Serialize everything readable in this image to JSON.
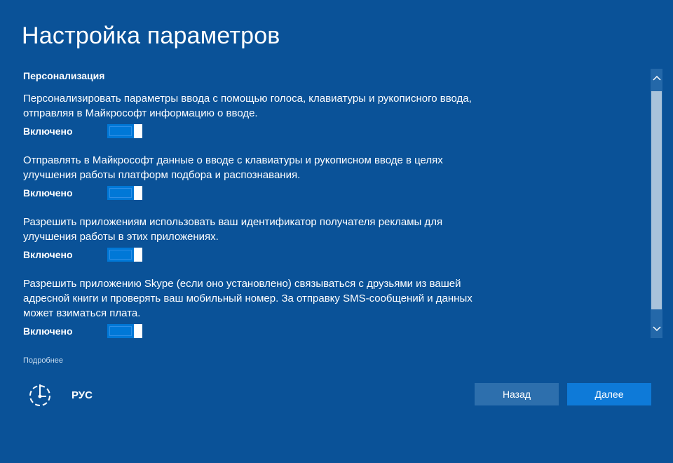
{
  "header": {
    "title": "Настройка параметров"
  },
  "section": {
    "title": "Персонализация",
    "settings": [
      {
        "description": "Персонализировать параметры ввода с помощью голоса, клавиатуры и рукописного ввода, отправляя в Майкрософт информацию о вводе.",
        "state_label": "Включено",
        "on": true
      },
      {
        "description": "Отправлять в Майкрософт данные о вводе с клавиатуры и рукописном вводе в целях улучшения работы платформ подбора и распознавания.",
        "state_label": "Включено",
        "on": true
      },
      {
        "description": "Разрешить приложениям использовать ваш идентификатор получателя рекламы для улучшения работы в этих приложениях.",
        "state_label": "Включено",
        "on": true
      },
      {
        "description": "Разрешить приложению Skype (если оно установлено) связываться с друзьями из вашей адресной книги и проверять ваш мобильный номер. За отправку SMS-сообщений и данных может взиматься плата.",
        "state_label": "Включено",
        "on": true
      }
    ]
  },
  "footer": {
    "more_link": "Подробнее",
    "language": "РУС",
    "back_label": "Назад",
    "next_label": "Далее"
  },
  "icons": {
    "accessibility": "ease-of-access-icon",
    "scroll_up": "chevron-up-icon",
    "scroll_down": "chevron-down-icon"
  },
  "colors": {
    "background": "#0a5298",
    "toggle_on": "#0078d7",
    "button_back": "#2d6fad",
    "button_next": "#0e7ad8"
  }
}
